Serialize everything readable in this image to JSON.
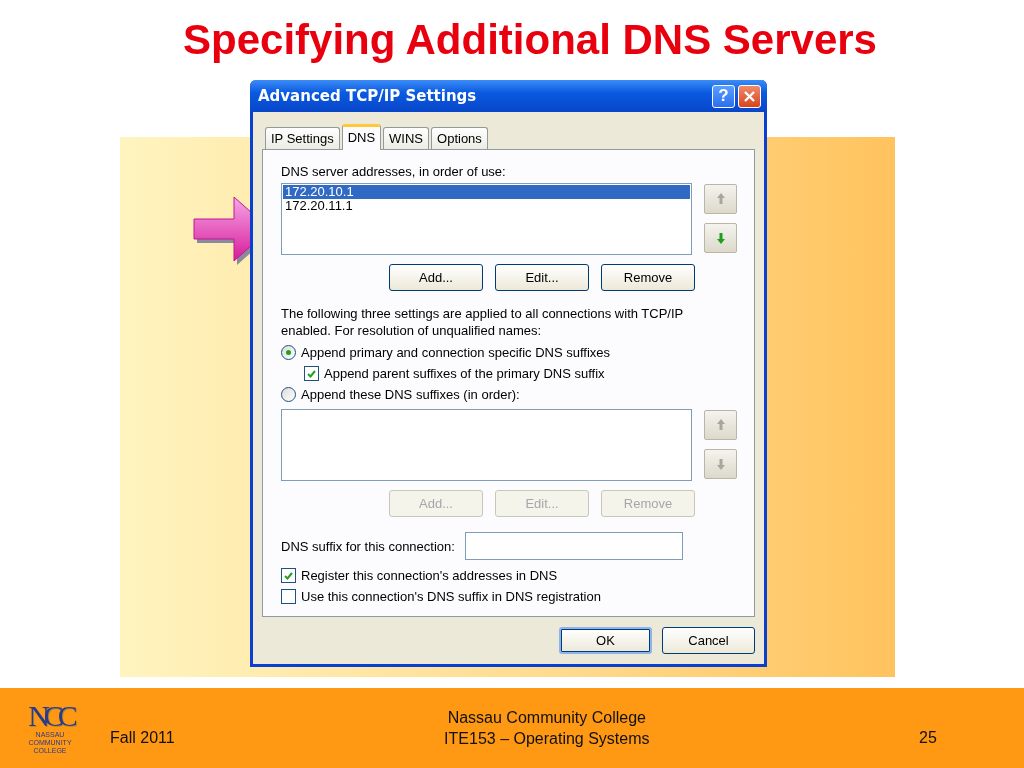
{
  "slide": {
    "title": "Specifying Additional DNS Servers"
  },
  "dialog": {
    "title": "Advanced TCP/IP Settings",
    "help_button": "?",
    "tabs": [
      {
        "label": "IP Settings",
        "selected": false
      },
      {
        "label": "DNS",
        "selected": true
      },
      {
        "label": "WINS",
        "selected": false
      },
      {
        "label": "Options",
        "selected": false
      }
    ],
    "dns_servers": {
      "label": "DNS server addresses, in order of use:",
      "items": [
        {
          "text": "172.20.10.1",
          "selected": true
        },
        {
          "text": "172.20.11.1",
          "selected": false
        }
      ],
      "move_buttons": [
        {
          "kind": "up",
          "disabled": true
        },
        {
          "kind": "down",
          "disabled": false
        }
      ],
      "buttons": [
        {
          "label": "Add...",
          "disabled": false
        },
        {
          "label": "Edit...",
          "disabled": false
        },
        {
          "label": "Remove",
          "disabled": false
        }
      ]
    },
    "description": "The following three settings are applied to all connections with TCP/IP enabled. For resolution of unqualified names:",
    "options": [
      {
        "kind": "radio",
        "label": "Append primary and connection specific DNS suffixes",
        "checked": true,
        "children": [
          {
            "kind": "checkbox",
            "label": "Append parent suffixes of the primary DNS suffix",
            "checked": true
          }
        ]
      },
      {
        "kind": "radio",
        "label": "Append these DNS suffixes (in order):",
        "checked": false
      }
    ],
    "suffixes": {
      "move_buttons": [
        {
          "kind": "up",
          "disabled": true
        },
        {
          "kind": "down",
          "disabled": true
        }
      ],
      "buttons": [
        {
          "label": "Add...",
          "disabled": true
        },
        {
          "label": "Edit...",
          "disabled": true
        },
        {
          "label": "Remove",
          "disabled": true
        }
      ]
    },
    "suffix_field": {
      "label": "DNS suffix for this connection:"
    },
    "registration": [
      {
        "label": "Register this connection's addresses in DNS",
        "checked": true
      },
      {
        "label": "Use this connection's DNS suffix in DNS registration",
        "checked": false
      }
    ],
    "footer_buttons": [
      {
        "label": "OK",
        "default": true
      },
      {
        "label": "Cancel",
        "default": false
      }
    ]
  },
  "footer": {
    "logo_mark": "NCC",
    "logo_text": "NASSAU COMMUNITY COLLEGE",
    "term": "Fall 2011",
    "lines": [
      "Nassau Community College",
      "ITE153 – Operating Systems"
    ],
    "page": "25"
  }
}
